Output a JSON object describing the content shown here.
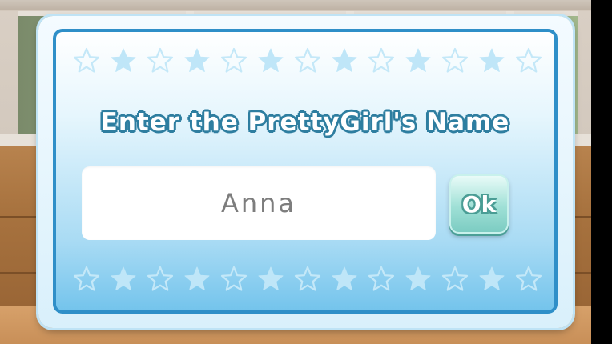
{
  "dialog": {
    "title": "Enter the PrettyGirl's Name",
    "name_input": {
      "value": "Anna",
      "placeholder": ""
    },
    "ok_label": "Ok"
  },
  "decor": {
    "star_icon": "star-icon",
    "stars_per_row": 13,
    "colors": {
      "frame_border": "#2f8fc8",
      "panel_top": "#ffffff",
      "panel_bottom": "#74c4ec",
      "title_outline": "#2e7ea0",
      "ok_button": "#9fe0d6",
      "name_text": "#7d7d7d"
    }
  }
}
